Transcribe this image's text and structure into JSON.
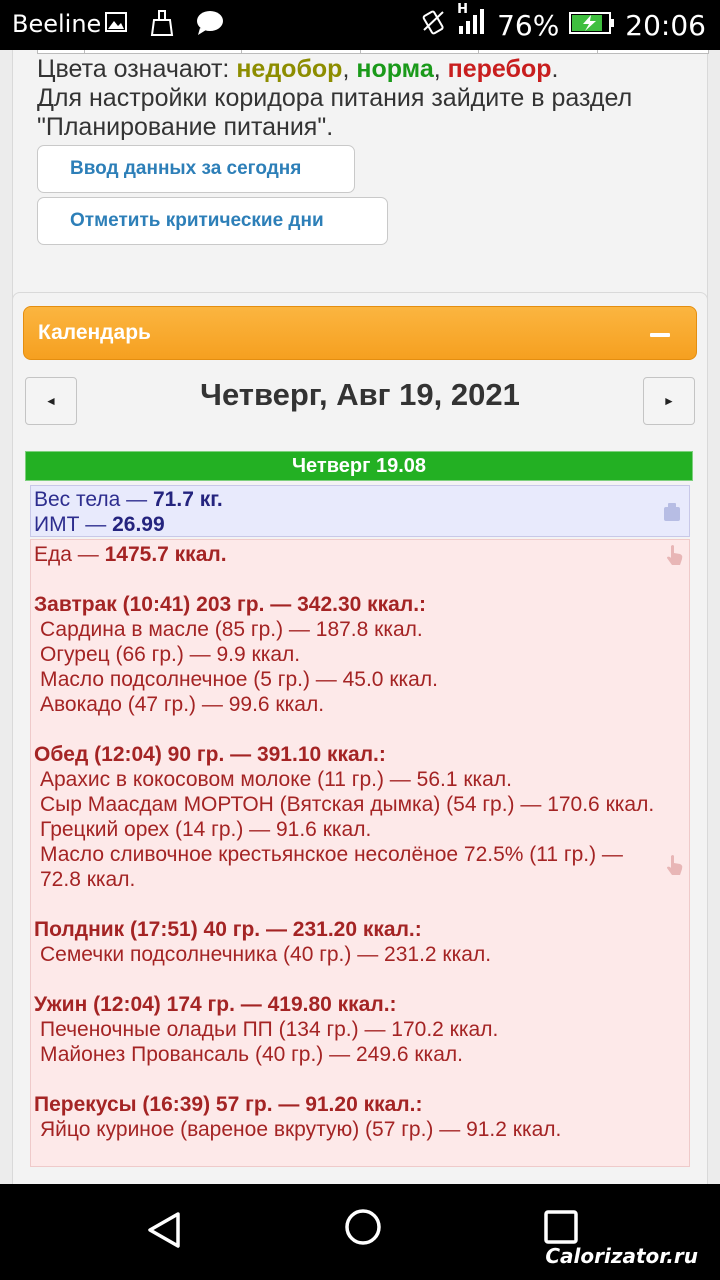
{
  "status_bar": {
    "carrier": "Beeline",
    "battery": "76%",
    "time": "20:06",
    "network": "H"
  },
  "info": {
    "colors_prefix": "Цвета означают: ",
    "color_under": "недобор",
    "sep1": ", ",
    "color_norm": "норма",
    "sep2": ", ",
    "color_over": "перебор",
    "end": ".",
    "hint": "Для настройки коридора питания зайдите в раздел \"Планирование питания\"."
  },
  "buttons": {
    "enter_today": "Ввод данных за сегодня",
    "mark_days": "Отметить критические дни"
  },
  "calendar": {
    "header": "Календарь",
    "date_title": "Четверг, Авг 19, 2021",
    "prev": "◄",
    "next": "►",
    "day_label": "Четверг 19.08"
  },
  "weight": {
    "weight_label": "Вес тела — ",
    "weight_value": "71.7 кг.",
    "bmi_label": "ИМТ — ",
    "bmi_value": "26.99"
  },
  "food": {
    "total_label": "Еда — ",
    "total_value": "1475.7 ккал.",
    "meals": [
      {
        "title": "Завтрак (10:41) 203 гр. — 342.30 ккал.:",
        "items": [
          "Сардина в масле (85 гр.) — 187.8 ккал.",
          "Огурец (66 гр.) — 9.9 ккал.",
          "Масло подсолнечное (5 гр.) — 45.0 ккал.",
          "Авокадо (47 гр.) — 99.6 ккал."
        ]
      },
      {
        "title": "Обед (12:04) 90 гр. — 391.10 ккал.:",
        "items": [
          "Арахис в кокосовом молоке (11 гр.) — 56.1 ккал.",
          "Сыр Маасдам МОРТОН (Вятская дымка) (54 гр.) — 170.6 ккал.",
          "Грецкий орех (14 гр.) — 91.6 ккал.",
          "Масло сливочное крестьянское несолёное 72.5% (11 гр.) — 72.8 ккал."
        ]
      },
      {
        "title": "Полдник (17:51) 40 гр. — 231.20 ккал.:",
        "items": [
          "Семечки подсолнечника (40 гр.) — 231.2 ккал."
        ]
      },
      {
        "title": "Ужин (12:04) 174 гр. — 419.80 ккал.:",
        "items": [
          "Печеночные оладьи ПП (134 гр.) — 170.2 ккал.",
          "Майонез Провансаль (40 гр.) — 249.6 ккал."
        ]
      },
      {
        "title": "Перекусы (16:39) 57 гр. — 91.20 ккал.:",
        "items": [
          "Яйцо куриное (вареное вкрутую) (57 гр.) — 91.2 ккал."
        ]
      }
    ]
  },
  "watermark": "Calorizator.ru"
}
